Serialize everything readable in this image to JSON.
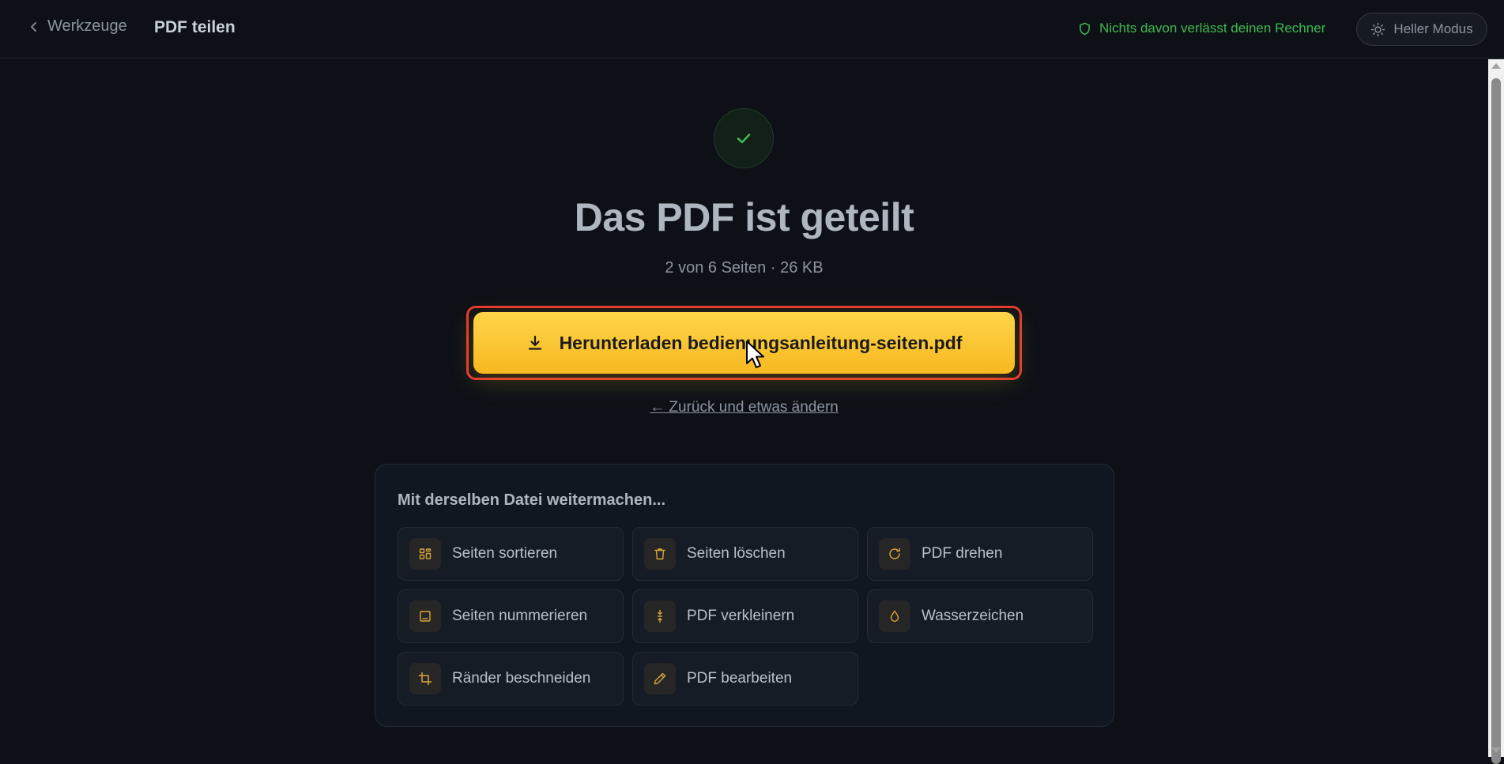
{
  "header": {
    "back_label": "Werkzeuge",
    "page_title": "PDF teilen",
    "privacy_text": "Nichts davon verlässt deinen Rechner",
    "theme_toggle_label": "Heller Modus"
  },
  "result": {
    "title": "Das PDF ist geteilt",
    "summary": "2 von 6 Seiten · 26 KB",
    "download_label": "Herunterladen bedienungsanleitung-seiten.pdf",
    "change_link": "← Zurück und etwas ändern"
  },
  "continue": {
    "title": "Mit derselben Datei weitermachen...",
    "tools": [
      {
        "label": "Seiten sortieren",
        "icon": "grid-icon"
      },
      {
        "label": "Seiten löschen",
        "icon": "trash-icon"
      },
      {
        "label": "PDF drehen",
        "icon": "rotate-icon"
      },
      {
        "label": "Seiten nummerieren",
        "icon": "page-number-icon"
      },
      {
        "label": "PDF verkleinern",
        "icon": "compress-icon"
      },
      {
        "label": "Wasserzeichen",
        "icon": "droplet-icon"
      },
      {
        "label": "Ränder beschneiden",
        "icon": "crop-icon"
      },
      {
        "label": "PDF bearbeiten",
        "icon": "pencil-icon"
      }
    ]
  },
  "colors": {
    "accent": "#f7b81f",
    "success": "#3fb950",
    "highlight_border": "#e5382c"
  }
}
